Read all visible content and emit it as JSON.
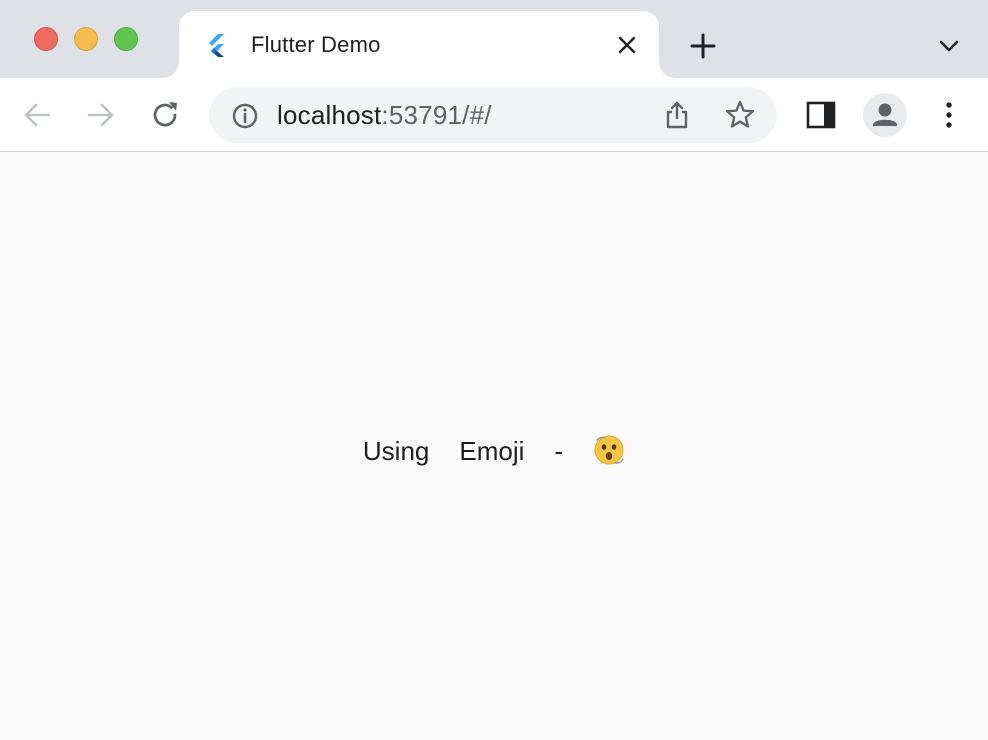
{
  "browser": {
    "tab_title": "Flutter Demo",
    "url_host": "localhost",
    "url_rest": ":53791/#/"
  },
  "content": {
    "words": [
      "Using",
      "Emoji",
      "-"
    ],
    "emoji_icon": "face-with-open-mouth-dizzy-emoji"
  },
  "colors": {
    "tabstrip": "#dee1e6",
    "page_background": "#f9f9f9",
    "omnibox": "#f1f3f4",
    "flutter_blue": "#42a5f5"
  }
}
